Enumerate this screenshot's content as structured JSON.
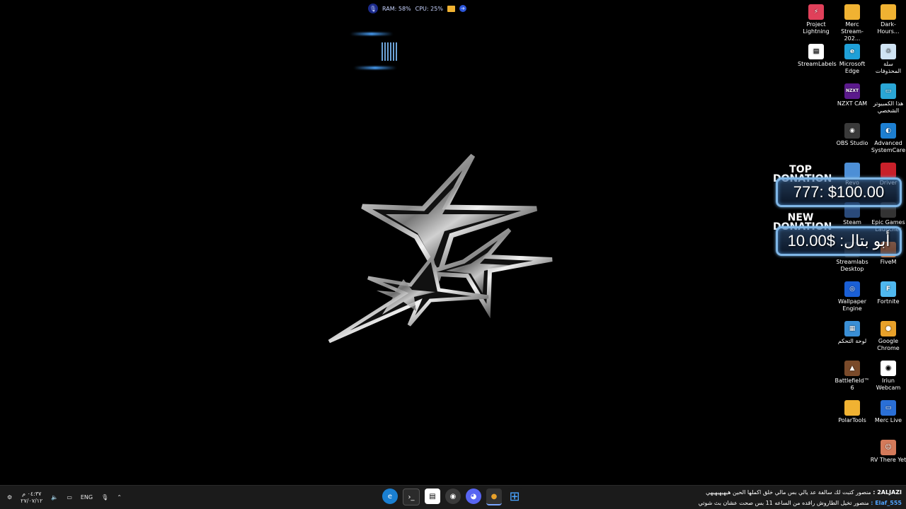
{
  "sysmon": {
    "ram": "RAM: 58%",
    "cpu": "CPU: 25%"
  },
  "desktop_icons": [
    {
      "label": "Project Lightning",
      "color": "#e0405a",
      "glyph": "⚡"
    },
    {
      "label": "Merc Stream-202...",
      "color": "#f0b232",
      "glyph": ""
    },
    {
      "label": "Dark-Hours...",
      "color": "#f0b232",
      "glyph": ""
    },
    {
      "label": "StreamLabels",
      "color": "#ffffff",
      "glyph": "▤"
    },
    {
      "label": "Microsoft Edge",
      "color": "#1fa0d8",
      "glyph": "e"
    },
    {
      "label": "سلة المحذوفات",
      "color": "#cfe3f3",
      "glyph": "♲"
    },
    {
      "label": "NZXT CAM",
      "color": "#5b1a8c",
      "glyph": "NZXT"
    },
    {
      "label": "هذا الكمبيوتر الشخصي",
      "color": "#2aa6d6",
      "glyph": "▭"
    },
    {
      "label": "OBS Studio",
      "color": "#3a3a3a",
      "glyph": "◉"
    },
    {
      "label": "Advanced SystemCare",
      "color": "#1d7fd1",
      "glyph": "◐"
    },
    {
      "label": "Revo",
      "color": "#4d8fd6",
      "glyph": ""
    },
    {
      "label": "Driver",
      "color": "#c8202a",
      "glyph": ""
    },
    {
      "label": "Steam",
      "color": "#2a4a7a",
      "glyph": ""
    },
    {
      "label": "Epic Games Launcher",
      "color": "#333333",
      "glyph": ""
    },
    {
      "label": "Streamlabs Desktop",
      "color": "#2a2a2a",
      "glyph": ""
    },
    {
      "label": "FiveM",
      "color": "#e06a1a",
      "glyph": ""
    },
    {
      "label": "Wallpaper Engine",
      "color": "#1a5fd6",
      "glyph": "◎"
    },
    {
      "label": "Fortnite",
      "color": "#4fb8ef",
      "glyph": "F"
    },
    {
      "label": "لوحة التحكم",
      "color": "#3a8fd6",
      "glyph": "▦"
    },
    {
      "label": "Google Chrome",
      "color": "#e8a12a",
      "glyph": "●"
    },
    {
      "label": "Battlefield™ 6",
      "color": "#7a4a2a",
      "glyph": "▲"
    },
    {
      "label": "Iriun Webcam",
      "color": "#ffffff",
      "glyph": "◉"
    },
    {
      "label": "PolarTools",
      "color": "#f0b232",
      "glyph": ""
    },
    {
      "label": "Merc Live",
      "color": "#2a6fd6",
      "glyph": "▭"
    },
    {
      "label": "RV There Yet",
      "color": "#d47a5a",
      "glyph": "☺"
    }
  ],
  "donations": {
    "top_label": "TOP DONATION",
    "top_value": "777: $100.00",
    "new_label": "NEW DONATION",
    "new_value": "أبو بتال: $10.00"
  },
  "taskbar": {
    "time": "٠٤:٣٧ م",
    "date": "٢٧/٠٧/١٢",
    "lang": "ENG",
    "chat": [
      {
        "user": "2ALJAZI :",
        "text": "منصور كتبت لك سالفة عد يالي بس مالي خلق اكملها الحين هيهيهيهيهي"
      },
      {
        "user": "Elaf_555 :",
        "text": "منصور تخيل الطاروش راقده من الساعه 11 بس صحت عشان بث شوتي"
      }
    ]
  }
}
